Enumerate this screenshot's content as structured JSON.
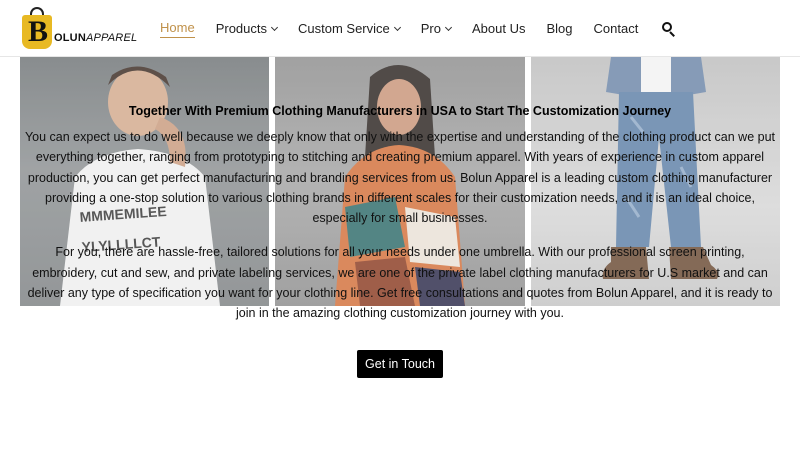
{
  "brand": {
    "logo_letter": "B",
    "name_bold": "OLUN",
    "name_rest": "APPAREL",
    "accent_color": "#e8b923"
  },
  "nav": {
    "items": [
      {
        "label": "Home",
        "active": true,
        "has_dropdown": false
      },
      {
        "label": "Products",
        "active": false,
        "has_dropdown": true
      },
      {
        "label": "Custom Service",
        "active": false,
        "has_dropdown": true
      },
      {
        "label": "Pro",
        "active": false,
        "has_dropdown": true
      },
      {
        "label": "About Us",
        "active": false,
        "has_dropdown": false
      },
      {
        "label": "Blog",
        "active": false,
        "has_dropdown": false
      },
      {
        "label": "Contact",
        "active": false,
        "has_dropdown": false
      }
    ],
    "search_icon": "search-icon",
    "active_color": "#c0914a"
  },
  "photos": {
    "photo_1_text": "MMMEMILEE\nYLYLLLLCT",
    "photo_2_text": "",
    "photo_3_text": ""
  },
  "content": {
    "heading": "Together With Premium Clothing Manufacturers in USA to Start The Customization Journey",
    "paragraph_1": "You can expect us to do well because we deeply know that only with the expertise and understanding of the clothing product can we put everything together, ranging from prototyping to stitching and creating premium apparel. With years of experience in custom apparel production, you can get perfect manufacturing and branding services from us. Bolun Apparel is a leading custom clothing manufacturer providing a one-stop solution to various clothing brands in different scales for their customization needs, and it is an ideal choice, especially for small businesses.",
    "paragraph_2": "For you, there are hassle-free, tailored solutions for all your needs under one umbrella. With our professional screen printing, embroidery, cut and sew, and private labeling services, we are one of the private label clothing manufacturers for U.S market and can deliver any type of specification you want for your clothing line. Get free consultations and quotes from Bolun Apparel, and it is ready to join in the amazing clothing customization journey with you."
  },
  "cta": {
    "label": "Get in Touch"
  }
}
